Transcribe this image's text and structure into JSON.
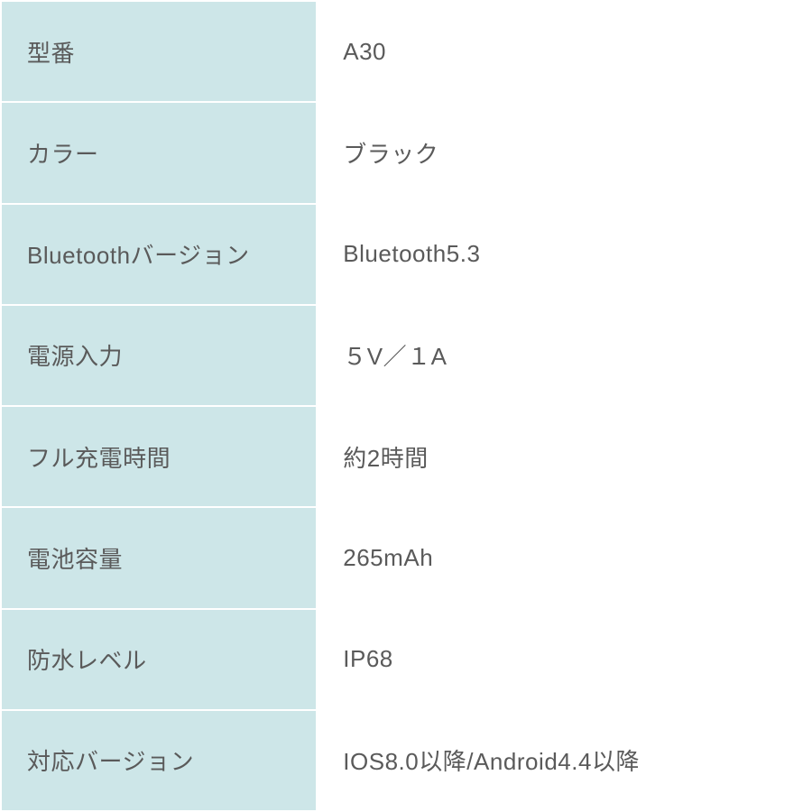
{
  "colors": {
    "label_bg": "#cde6e8",
    "value_bg": "#ffffff",
    "text": "#5a5a5a"
  },
  "specs": [
    {
      "label": "型番",
      "value": "A30"
    },
    {
      "label": "カラー",
      "value": "ブラック"
    },
    {
      "label": "Bluetoothバージョン",
      "value": "Bluetooth5.3"
    },
    {
      "label": "電源入力",
      "value": "５V／１A"
    },
    {
      "label": "フル充電時間",
      "value": "約2時間"
    },
    {
      "label": "電池容量",
      "value": "265mAh"
    },
    {
      "label": "防水レベル",
      "value": "IP68"
    },
    {
      "label": "対応バージョン",
      "value": "IOS8.0以降/Android4.4以降"
    }
  ]
}
